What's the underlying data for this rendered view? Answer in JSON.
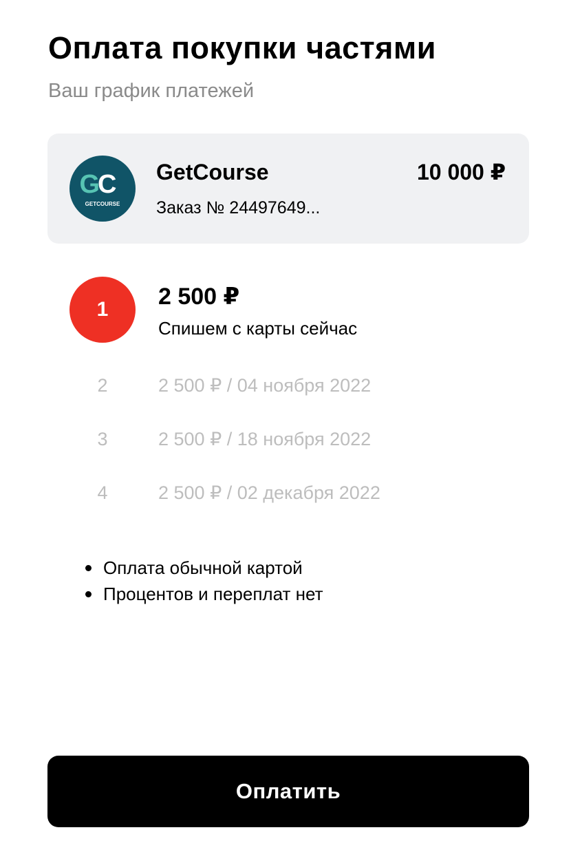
{
  "header": {
    "title": "Оплата покупки частями",
    "subtitle": "Ваш график платежей"
  },
  "merchant": {
    "name": "GetCourse",
    "order": "Заказ № 24497649...",
    "amount": "10 000 ₽",
    "logo": {
      "icon": "getcourse-logo",
      "monogram": "GC",
      "wordmark": "GETCOURSE"
    }
  },
  "schedule": {
    "current": {
      "number": "1",
      "amount": "2 500 ₽",
      "description": "Спишем с карты сейчас"
    },
    "upcoming": [
      {
        "number": "2",
        "text": "2 500 ₽ / 04 ноября 2022"
      },
      {
        "number": "3",
        "text": "2 500 ₽ / 18 ноября 2022"
      },
      {
        "number": "4",
        "text": "2 500 ₽ / 02 декабря 2022"
      }
    ]
  },
  "features": [
    "Оплата обычной картой",
    "Процентов и переплат нет"
  ],
  "actions": {
    "pay_label": "Оплатить"
  },
  "colors": {
    "card_background": "#f0f1f3",
    "accent_red": "#ee3024",
    "logo_background": "#105467",
    "logo_accent": "#57c4b3",
    "muted_text": "#8a8a8a",
    "upcoming_text": "#bdbdbd",
    "button_background": "#000000"
  }
}
